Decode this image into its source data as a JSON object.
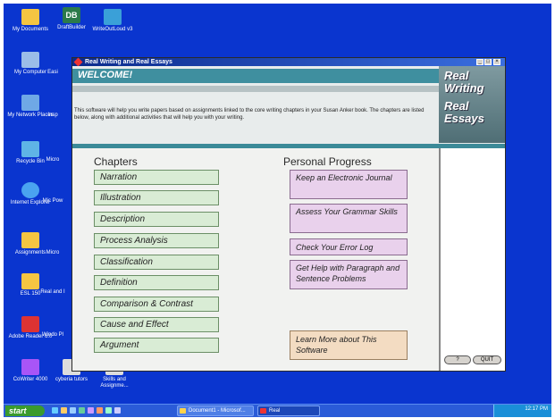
{
  "desktop": {
    "icons": [
      {
        "label": "My Documents",
        "color": "#f5c542"
      },
      {
        "label": "DraftBuilder",
        "color": "#2b7a4b"
      },
      {
        "label": "WriteOutLoud v3",
        "color": "#3aa0d8"
      },
      {
        "label": "My Computer",
        "color": "#9bbde8"
      },
      {
        "label": "Easi",
        "color": "#d0d0d0"
      },
      {
        "label": "My Network Places",
        "color": "#6fa8e6"
      },
      {
        "label": "Insp",
        "color": "#88c"
      },
      {
        "label": "Recycle Bin",
        "color": "#5fb4e6"
      },
      {
        "label": "Micro",
        "color": "#d8d8d8"
      },
      {
        "label": "Internet Explorer",
        "color": "#4aa3f0"
      },
      {
        "label": "Mic Pow",
        "color": "#c96"
      },
      {
        "label": "Assignments",
        "color": "#f5c542"
      },
      {
        "label": "Micro",
        "color": "#d8d8d8"
      },
      {
        "label": "ESL 150",
        "color": "#f5c542"
      },
      {
        "label": "Real and I",
        "color": "#b44"
      },
      {
        "label": "Adobe Reader 6.0",
        "color": "#d33"
      },
      {
        "label": "Windo Pl",
        "color": "#ccc"
      },
      {
        "label": "CoWriter 4000",
        "color": "#a855f7"
      },
      {
        "label": "cyberia tutors",
        "color": "#ddd"
      },
      {
        "label": "Skills and Assignme...",
        "color": "#ddd"
      }
    ]
  },
  "taskbar": {
    "start_label": "start",
    "tasks": [
      "Document1 - Microsof...",
      "Real"
    ],
    "clock": "12:17 PM"
  },
  "window": {
    "title": "Real Writing and Real Essays",
    "welcome": "WELCOME!",
    "logo_words": [
      "Real",
      "Writing",
      "Real",
      "Essays"
    ],
    "intro": "This software will help you write papers based on assignments linked to the core writing chapters in your Susan Anker book. The chapters are listed below, along with additional activities that will help you with your writing.",
    "chapters_heading": "Chapters",
    "chapters": [
      "Narration",
      "Illustration",
      "Description",
      "Process Analysis",
      "Classification",
      "Definition",
      "Comparison & Contrast",
      "Cause and Effect",
      "Argument"
    ],
    "progress_heading": "Personal Progress",
    "progress_items": [
      "Keep an Electronic Journal",
      "Assess Your Grammar Skills",
      "Check Your Error Log",
      "Get Help with Paragraph and Sentence Problems"
    ],
    "learn_more": "Learn More about This Software",
    "help_label": "?",
    "quit_label": "QUIT"
  },
  "colors": {
    "desktop": "#0a35cf",
    "chapter_button": "#d9ecd5",
    "progress_button": "#e9d1ec",
    "learn_button": "#f3dcc2",
    "teal": "#3f8f9f"
  }
}
